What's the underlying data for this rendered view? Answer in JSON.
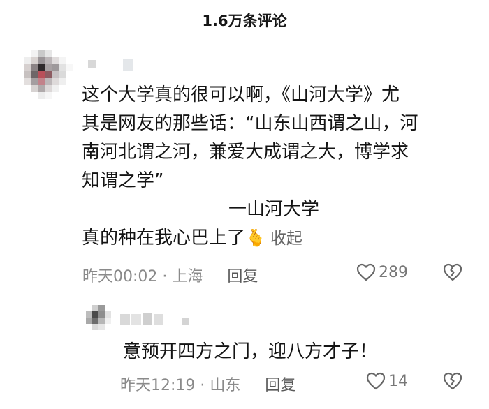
{
  "header": {
    "title": "1.6万条评论"
  },
  "comment": {
    "lines": [
      "这个大学真的很可以啊，《山河大学》尤",
      "其是网友的那些话：“山东山西谓之山，河",
      "南河北谓之河，兼爱大成谓之大，博学求",
      "知谓之学”",
      "一山河大学",
      "真的种在我心巴上了"
    ],
    "emoji": "🫰",
    "collapse_label": "收起",
    "time": "昨天00:02",
    "separator": "·",
    "location": "上海",
    "reply_label": "回复",
    "like_count": "289",
    "colors": {
      "meta": "#8a8a8a",
      "icon": "#666666"
    }
  },
  "reply": {
    "text": "意预开四方之门，迎八方才子！",
    "time": "昨天12:19",
    "separator": "·",
    "location": "山东",
    "reply_label": "回复",
    "like_count": "14"
  },
  "icons": {
    "like": "heart-outline-icon",
    "dislike": "broken-heart-icon"
  }
}
